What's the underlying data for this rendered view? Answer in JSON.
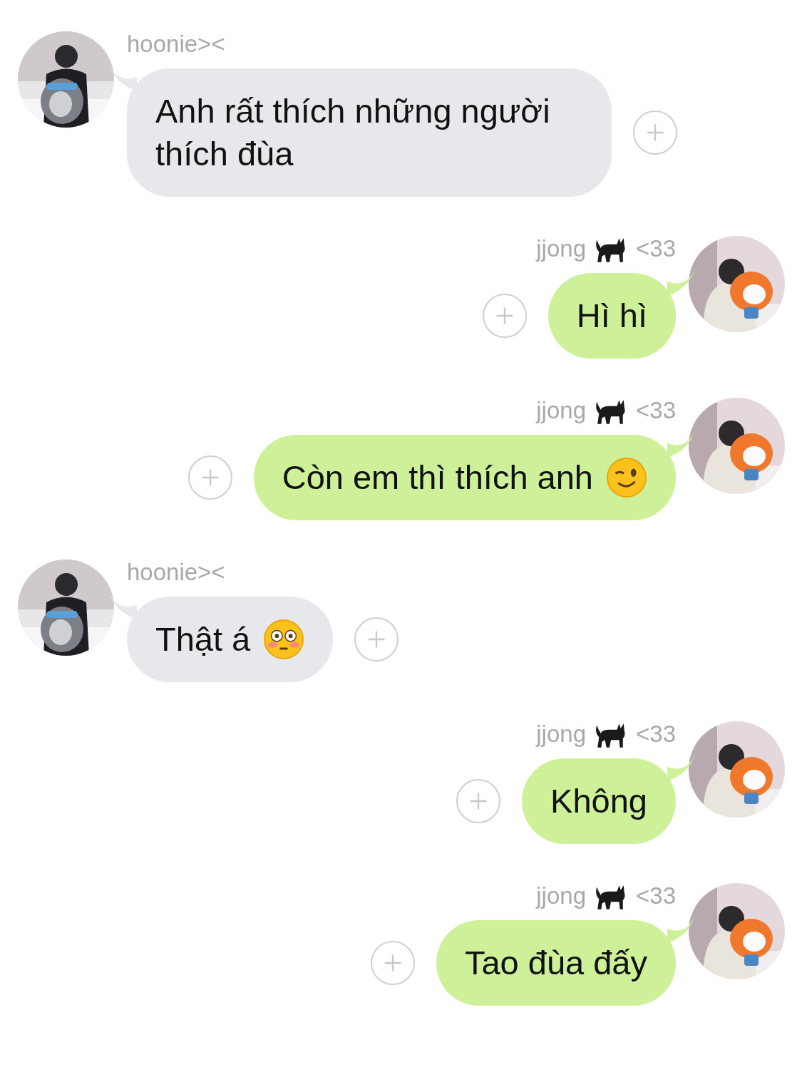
{
  "messages": [
    {
      "kind": "incoming",
      "sender": [
        {
          "kind": "text",
          "text": "hoonie><"
        }
      ],
      "content": [
        {
          "kind": "text",
          "text": "Anh rất thích những người thích đùa"
        }
      ]
    },
    {
      "kind": "outgoing",
      "sender": [
        {
          "kind": "text",
          "text": "jjong"
        },
        {
          "kind": "cat"
        },
        {
          "kind": "text",
          "text": "<33"
        }
      ],
      "content": [
        {
          "kind": "text",
          "text": "Hì hì"
        }
      ]
    },
    {
      "kind": "outgoing",
      "sender": [
        {
          "kind": "text",
          "text": "jjong"
        },
        {
          "kind": "cat"
        },
        {
          "kind": "text",
          "text": "<33"
        }
      ],
      "content": [
        {
          "kind": "text",
          "text": "Còn em thì thích anh"
        },
        {
          "kind": "wink"
        }
      ]
    },
    {
      "kind": "incoming",
      "sender": [
        {
          "kind": "text",
          "text": "hoonie><"
        }
      ],
      "content": [
        {
          "kind": "text",
          "text": "Thật á"
        },
        {
          "kind": "flushed"
        }
      ]
    },
    {
      "kind": "outgoing",
      "sender": [
        {
          "kind": "text",
          "text": "jjong"
        },
        {
          "kind": "cat"
        },
        {
          "kind": "text",
          "text": "<33"
        }
      ],
      "content": [
        {
          "kind": "text",
          "text": "Không"
        }
      ]
    },
    {
      "kind": "outgoing",
      "sender": [
        {
          "kind": "text",
          "text": "jjong"
        },
        {
          "kind": "cat"
        },
        {
          "kind": "text",
          "text": "<33"
        }
      ],
      "content": [
        {
          "kind": "text",
          "text": "Tao đùa đấy"
        }
      ]
    }
  ]
}
